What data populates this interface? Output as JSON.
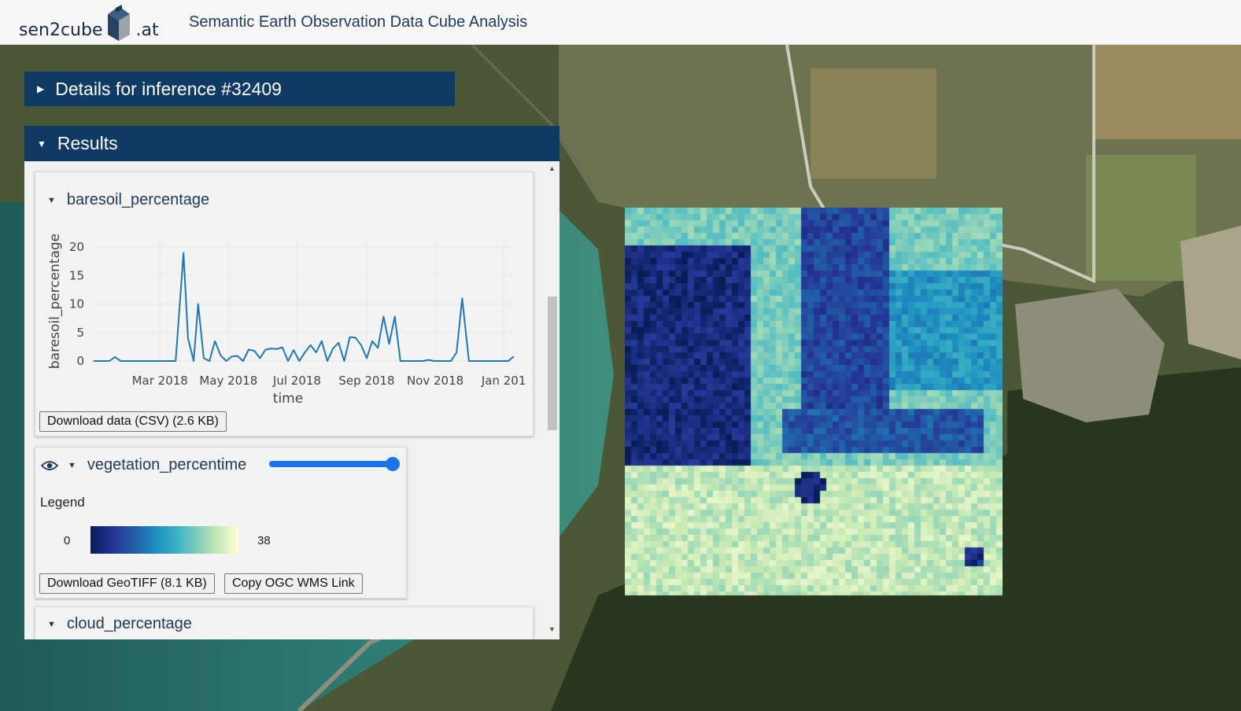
{
  "header": {
    "logo_left": "sen2cube",
    "logo_right": ".at",
    "title": "Semantic Earth Observation Data Cube Analysis"
  },
  "details_panel": {
    "title": "Details for inference #32409",
    "expanded": false
  },
  "results_panel": {
    "title": "Results",
    "expanded": true,
    "baresoil": {
      "title": "baresoil_percentage",
      "download_button": "Download data (CSV) (2.6 KB)"
    },
    "vegetation": {
      "title": "vegetation_percentime",
      "visibility_icon": "eye-icon",
      "opacity": 1.0,
      "legend_title": "Legend",
      "legend_min": "0",
      "legend_max": "38",
      "download_button": "Download GeoTIFF (8.1 KB)",
      "wms_button": "Copy OGC WMS Link"
    },
    "cloud": {
      "title": "cloud_percentage"
    }
  },
  "colors": {
    "panel_header": "#0f3a63",
    "line": "#1f77b4",
    "slider": "#1a73e8",
    "legend_scale": [
      "#081d58",
      "#253494",
      "#225ea8",
      "#1d91c0",
      "#41b6c4",
      "#7fcdbb",
      "#c7e9b4",
      "#ffffd9"
    ]
  },
  "chart_data": {
    "type": "line",
    "xlabel": "time",
    "ylabel": "baresoil_percentage",
    "ylim": [
      0,
      21
    ],
    "y_ticks": [
      "0",
      "5",
      "10",
      "15",
      "20"
    ],
    "x_tick_labels": [
      "Mar 2018",
      "May 2018",
      "Jul 2018",
      "Sep 2018",
      "Nov 2018",
      "Jan 201"
    ],
    "x_range": [
      "2018-01-01",
      "2019-01-10"
    ],
    "grid": true,
    "series": [
      {
        "x": [
          "2018-01-01",
          "2018-01-08",
          "2018-01-15",
          "2018-01-20",
          "2018-01-25",
          "2018-02-05",
          "2018-02-15",
          "2018-03-01",
          "2018-03-10",
          "2018-03-15",
          "2018-03-22",
          "2018-03-26",
          "2018-03-31",
          "2018-04-04",
          "2018-04-09",
          "2018-04-14",
          "2018-04-19",
          "2018-04-24",
          "2018-04-29",
          "2018-05-04",
          "2018-05-09",
          "2018-05-14",
          "2018-05-19",
          "2018-05-24",
          "2018-05-29",
          "2018-06-03",
          "2018-06-08",
          "2018-06-13",
          "2018-06-18",
          "2018-06-23",
          "2018-06-28",
          "2018-07-03",
          "2018-07-08",
          "2018-07-13",
          "2018-07-18",
          "2018-07-23",
          "2018-07-28",
          "2018-08-02",
          "2018-08-07",
          "2018-08-12",
          "2018-08-17",
          "2018-08-22",
          "2018-08-27",
          "2018-09-01",
          "2018-09-06",
          "2018-09-11",
          "2018-09-16",
          "2018-09-21",
          "2018-09-26",
          "2018-10-01",
          "2018-10-06",
          "2018-10-11",
          "2018-10-16",
          "2018-10-21",
          "2018-10-26",
          "2018-10-31",
          "2018-11-05",
          "2018-11-10",
          "2018-11-15",
          "2018-11-20",
          "2018-11-25",
          "2018-12-01",
          "2018-12-10",
          "2018-12-20",
          "2018-12-30",
          "2019-01-05",
          "2019-01-10"
        ],
        "y": [
          0,
          0,
          0,
          0.7,
          0,
          0,
          0,
          0,
          0,
          0,
          19,
          4,
          0,
          10,
          0.5,
          0,
          3.5,
          1,
          0,
          0.8,
          0.9,
          0,
          2,
          1.8,
          0.5,
          2,
          2.2,
          2.1,
          2.4,
          0,
          1.9,
          0,
          1.5,
          2.8,
          1.5,
          3.5,
          0,
          2.2,
          3.2,
          0,
          4.2,
          4.1,
          2.8,
          0.5,
          3.5,
          2.3,
          7.8,
          3,
          7.8,
          0,
          0,
          0,
          0,
          0,
          0.2,
          0,
          0,
          0,
          0,
          1.5,
          11,
          0,
          0,
          0,
          0,
          0,
          0.8
        ]
      }
    ]
  }
}
